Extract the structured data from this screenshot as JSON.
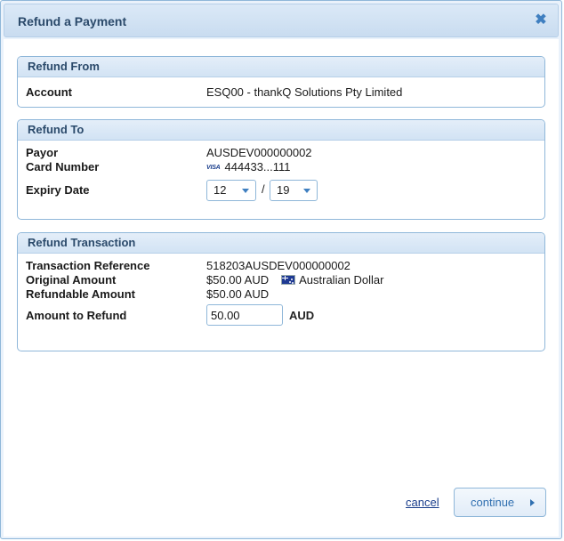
{
  "dialog": {
    "title": "Refund a Payment",
    "close_icon": "close-icon",
    "close_glyph": "✖"
  },
  "refund_from": {
    "header": "Refund From",
    "account_label": "Account",
    "account_value": "ESQ00 - thankQ Solutions Pty Limited"
  },
  "refund_to": {
    "header": "Refund To",
    "payor_label": "Payor",
    "payor_value": "AUSDEV000000002",
    "card_label": "Card Number",
    "card_brand": "VISA",
    "card_value": "444433...111",
    "expiry_label": "Expiry Date",
    "expiry_month": "12",
    "expiry_separator": "/",
    "expiry_year": "19"
  },
  "refund_transaction": {
    "header": "Refund Transaction",
    "ref_label": "Transaction Reference",
    "ref_value": "518203AUSDEV000000002",
    "original_label": "Original Amount",
    "original_value": "$50.00 AUD",
    "currency_name": "Australian Dollar",
    "refundable_label": "Refundable Amount",
    "refundable_value": "$50.00 AUD",
    "amount_label": "Amount to Refund",
    "amount_value": "50.00",
    "amount_currency": "AUD"
  },
  "actions": {
    "cancel_label": "cancel",
    "continue_label": "continue"
  },
  "colors": {
    "accent": "#3f7fc0",
    "border": "#8fb7d9",
    "header_text": "#2b4a6b"
  }
}
